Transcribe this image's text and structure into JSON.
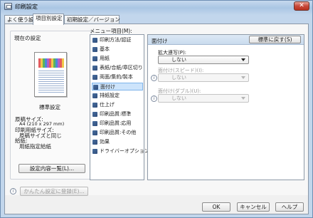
{
  "window": {
    "title": "印刷設定",
    "close_glyph": "✕"
  },
  "tabs": [
    {
      "label": "よく使う設定"
    },
    {
      "label": "項目別設定"
    },
    {
      "label": "初期設定／バージョン"
    }
  ],
  "current_settings": {
    "heading": "現在の設定",
    "preset_name": "標準設定",
    "details": [
      "原稿サイズ:",
      "A4 (210 x 297 mm)",
      "印刷用紙サイズ:",
      "原稿サイズと同じ",
      "給紙:",
      "用紙指定給紙"
    ],
    "list_button": "設定内容一覧(L)...",
    "register_button": "かんたん設定に登録(E)..."
  },
  "menu": {
    "label": "メニュー項目(M):",
    "items": [
      {
        "label": "印刷方法/認証"
      },
      {
        "label": "基本"
      },
      {
        "label": "用紙"
      },
      {
        "label": "表紙/合紙/章区切り"
      },
      {
        "label": "両面/集約/製本"
      },
      {
        "label": "面付け"
      },
      {
        "label": "排紙設定"
      },
      {
        "label": "仕上げ"
      },
      {
        "label": "印刷品質:標準"
      },
      {
        "label": "印刷品質:応用"
      },
      {
        "label": "印刷品質:その他"
      },
      {
        "label": "効果"
      },
      {
        "label": "ドライバーオプション"
      }
    ]
  },
  "panel": {
    "title": "面付け",
    "reset_button": "標準に戻す(S)",
    "fields": [
      {
        "label": "拡大連写(P):",
        "value": "しない",
        "enabled": true
      },
      {
        "label": "面付け(スピード)(I):",
        "value": "しない",
        "enabled": false
      },
      {
        "label": "面付け(ダブル)(U):",
        "value": "しない",
        "enabled": false
      }
    ]
  },
  "footer": {
    "ok": "OK",
    "cancel": "キャンセル",
    "help": "ヘルプ"
  },
  "colors": {
    "selection": "#cde4fb",
    "panel_header": "#c9dbee",
    "title_bar": "#aac6e4"
  }
}
